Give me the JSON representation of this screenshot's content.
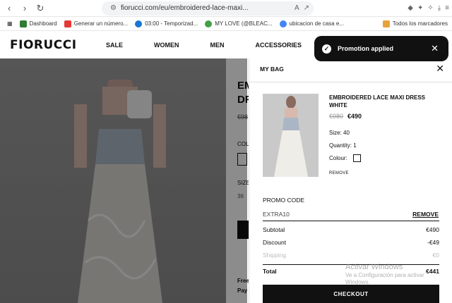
{
  "browser": {
    "url": "fiorucci.com/eu/embroidered-lace-maxi...",
    "bookmarks": [
      "Dashboard",
      "Generar un número...",
      "03:00 - Temporizad...",
      "MY LOVE (@BLEAC...",
      "ubicacion de casa e...",
      "Todos los marcadores"
    ],
    "bookmark_colors": [
      "#2e7d32",
      "#e53935",
      "#1976d2",
      "#43a047",
      "#4285f4",
      "#e6a23c"
    ]
  },
  "site": {
    "logo": "FIORUCCI",
    "menu": [
      "SALE",
      "WOMEN",
      "MEN",
      "ACCESSORIES"
    ]
  },
  "product_page_partial": {
    "title_line1": "EM",
    "title_line2": "DR",
    "old_price": "€98",
    "colour_label": "COL",
    "size_label": "SIZE",
    "size_value": "36",
    "free_text": "Free",
    "pay_text": "Pay"
  },
  "toast": {
    "message": "Promotion applied"
  },
  "bag": {
    "title": "MY BAG",
    "item": {
      "name": "EMBROIDERED LACE MAXI DRESS WHITE",
      "old_price": "€980",
      "new_price": "€490",
      "size": "Size: 40",
      "quantity": "Quantity: 1",
      "colour": "Colour:",
      "remove": "REMOVE"
    },
    "promo": {
      "label": "PROMO CODE",
      "code": "EXTRA10",
      "remove": "REMOVE"
    },
    "summary": [
      {
        "label": "Subtotal",
        "value": "€490"
      },
      {
        "label": "Discount",
        "value": "-€49"
      },
      {
        "label": "Shipping",
        "value": "€0"
      },
      {
        "label": "Total",
        "value": "€441"
      }
    ],
    "checkout": "CHECKOUT"
  },
  "watermark": {
    "line1": "Activar Windows",
    "line2": "Ve a Configuración para activar",
    "line3": "Windows."
  }
}
